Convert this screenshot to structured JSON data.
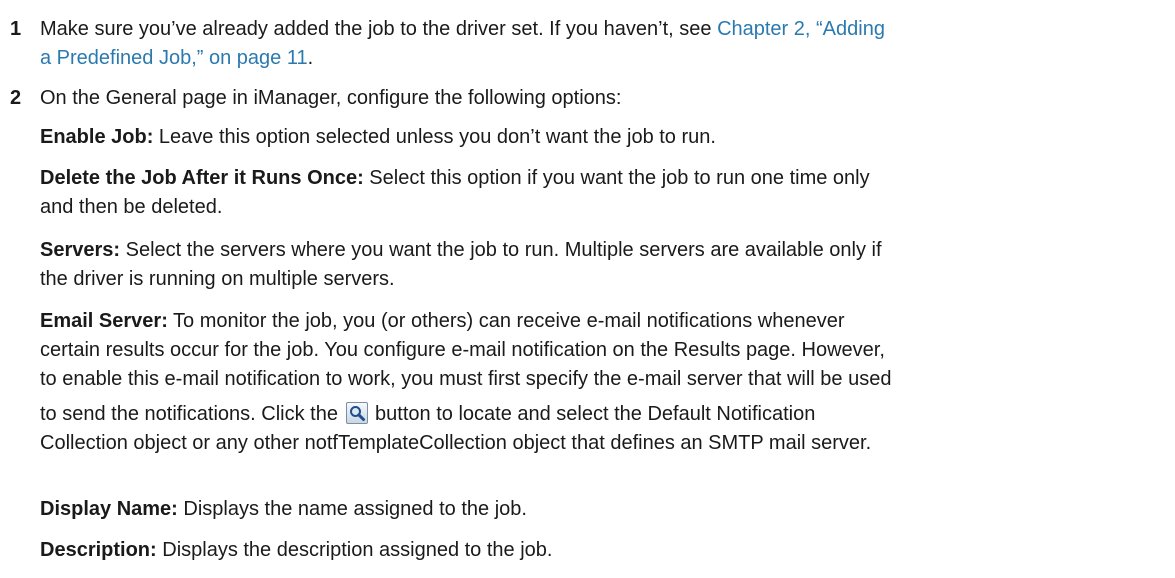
{
  "step1": {
    "number": "1",
    "text_before": "Make sure you’ve already added the job to the driver set. If you haven’t, see ",
    "link_line1": "Chapter 2, “Adding",
    "link_line2": "a Predefined Job,” on page 11",
    "text_after": "."
  },
  "step2": {
    "number": "2",
    "text": "On the General page in iManager, configure the following options:"
  },
  "options": {
    "enable_job": {
      "label": "Enable Job:",
      "text": " Leave this option selected unless you don’t want the job to run."
    },
    "delete_job": {
      "label": "Delete the Job After it Runs Once:",
      "text_line1": " Select this option if you want the job to run one time only",
      "text_line2": "and then be deleted."
    },
    "servers": {
      "label": "Servers:",
      "text_line1": " Select the servers where you want the job to run. Multiple servers are available only if",
      "text_line2": "the driver is running on multiple servers."
    },
    "email_server": {
      "label": "Email Server:",
      "text_line1": " To monitor the job, you (or others) can receive e-mail notifications whenever",
      "text_line2": "certain results occur for the job. You configure e-mail notification on the Results page. However,",
      "text_line3": "to enable this e-mail notification to work, you must first specify the e-mail server that will be used",
      "text_line4_before": "to send the notifications. Click the ",
      "button_icon": "search-icon",
      "text_line4_after": " button to locate and select the Default Notification",
      "text_line5": "Collection object or any other notfTemplateCollection object that defines an SMTP mail server."
    },
    "display_name": {
      "label": "Display Name:",
      "text": " Displays the name assigned to the job."
    },
    "description": {
      "label": "Description:",
      "text": " Displays the description assigned to the job."
    }
  },
  "colors": {
    "link": "#2a7ab0",
    "text": "#1a1a1a"
  }
}
